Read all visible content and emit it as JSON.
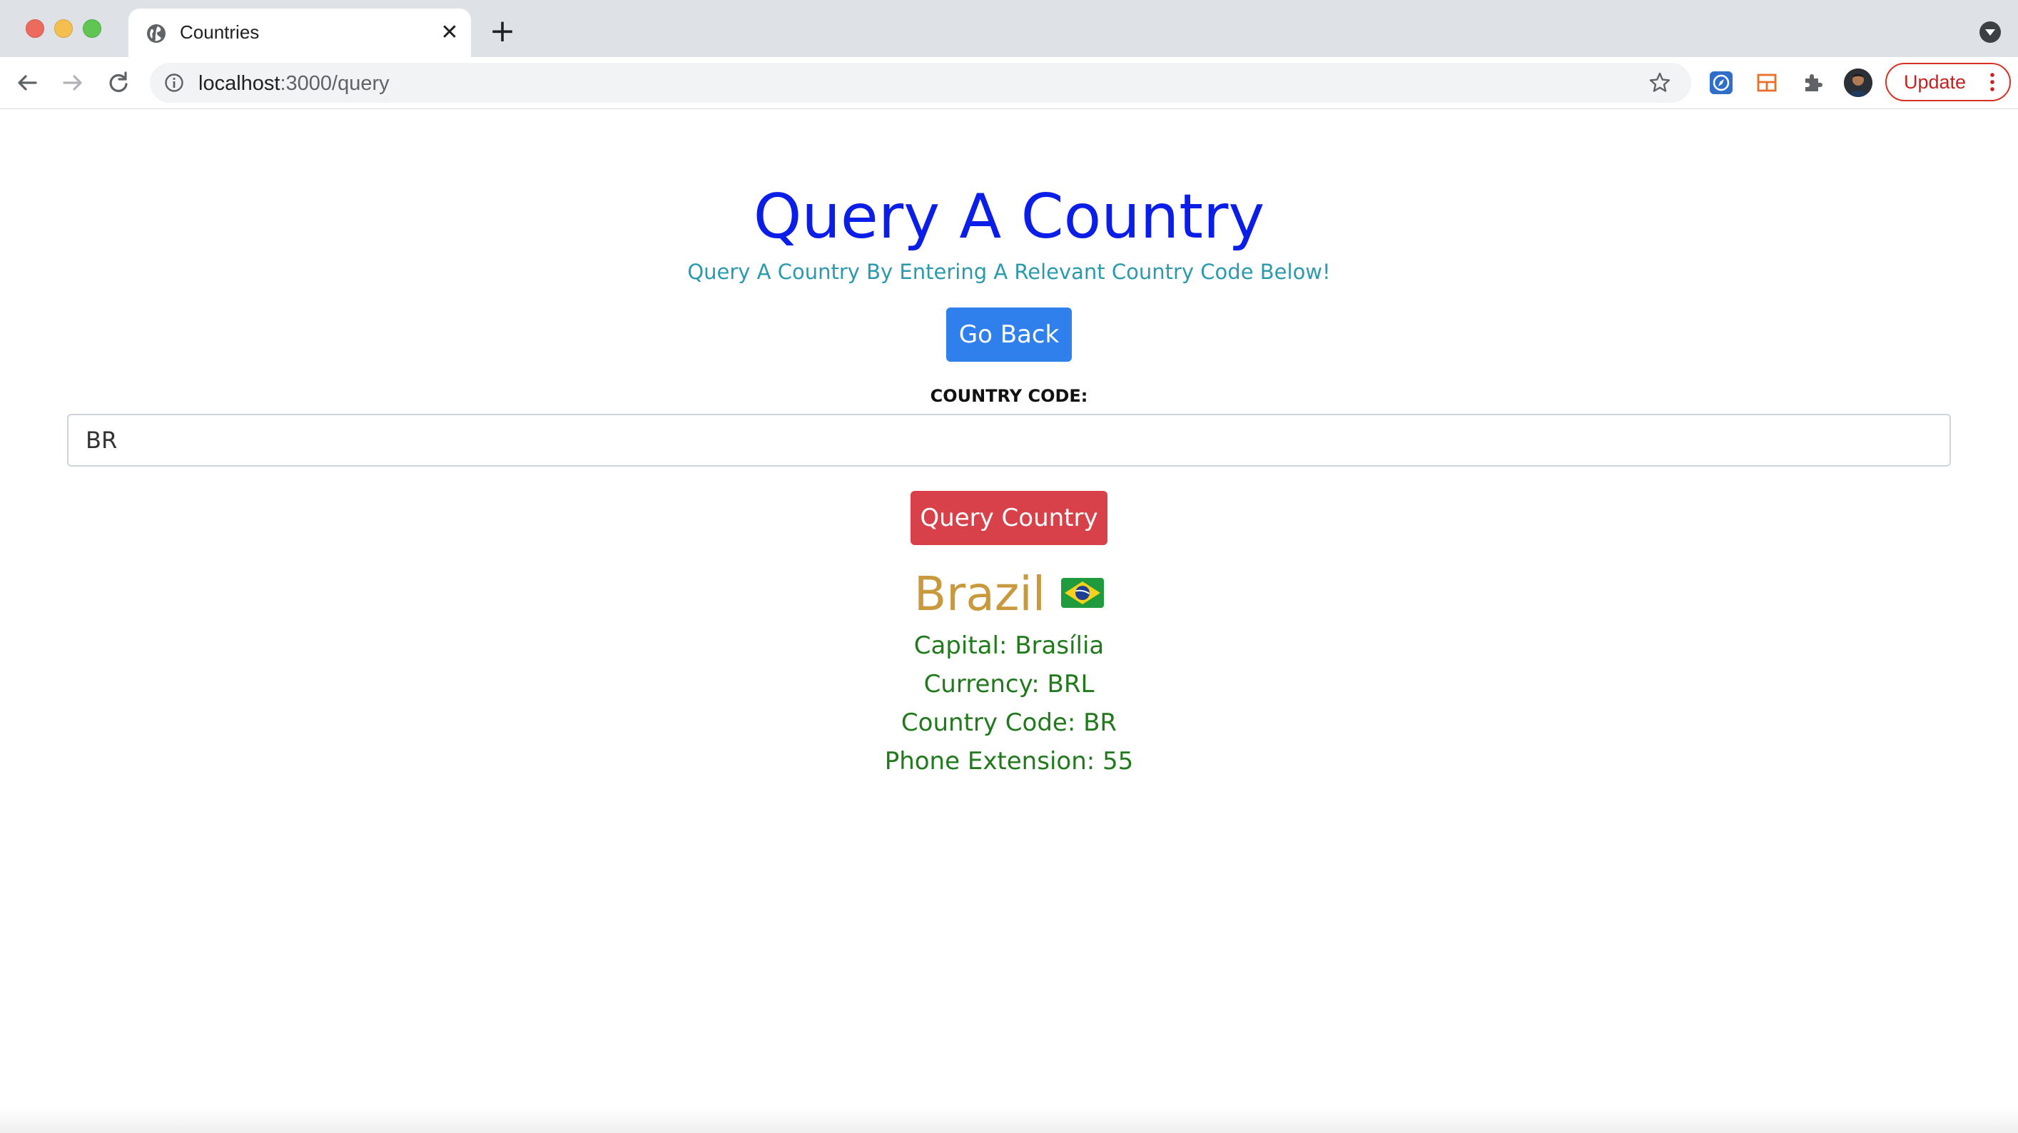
{
  "browser": {
    "tab_title": "Countries",
    "url_host": "localhost",
    "url_rest": ":3000/query",
    "update_label": "Update",
    "colors": {
      "tabbar": "#dee1e6",
      "update_border": "#d93025"
    }
  },
  "page": {
    "title": "Query A Country",
    "subtitle": "Query A Country By Entering A Relevant Country Code Below!",
    "go_back_label": "Go Back",
    "country_code_label": "COUNTRY CODE:",
    "country_code_value": "BR",
    "query_button_label": "Query Country",
    "colors": {
      "title": "#0b1ee8",
      "subtitle": "#2b9aaf",
      "go_back": "#2f80ed",
      "query_button": "#d9414a",
      "country_name": "#c99a3d",
      "details": "#207a1c"
    }
  },
  "result": {
    "country_name": "Brazil",
    "flag_icon": "brazil-flag-icon",
    "capital": "Capital: Brasília",
    "currency": "Currency: BRL",
    "country_code": "Country Code: BR",
    "phone_extension": "Phone Extension: 55"
  }
}
